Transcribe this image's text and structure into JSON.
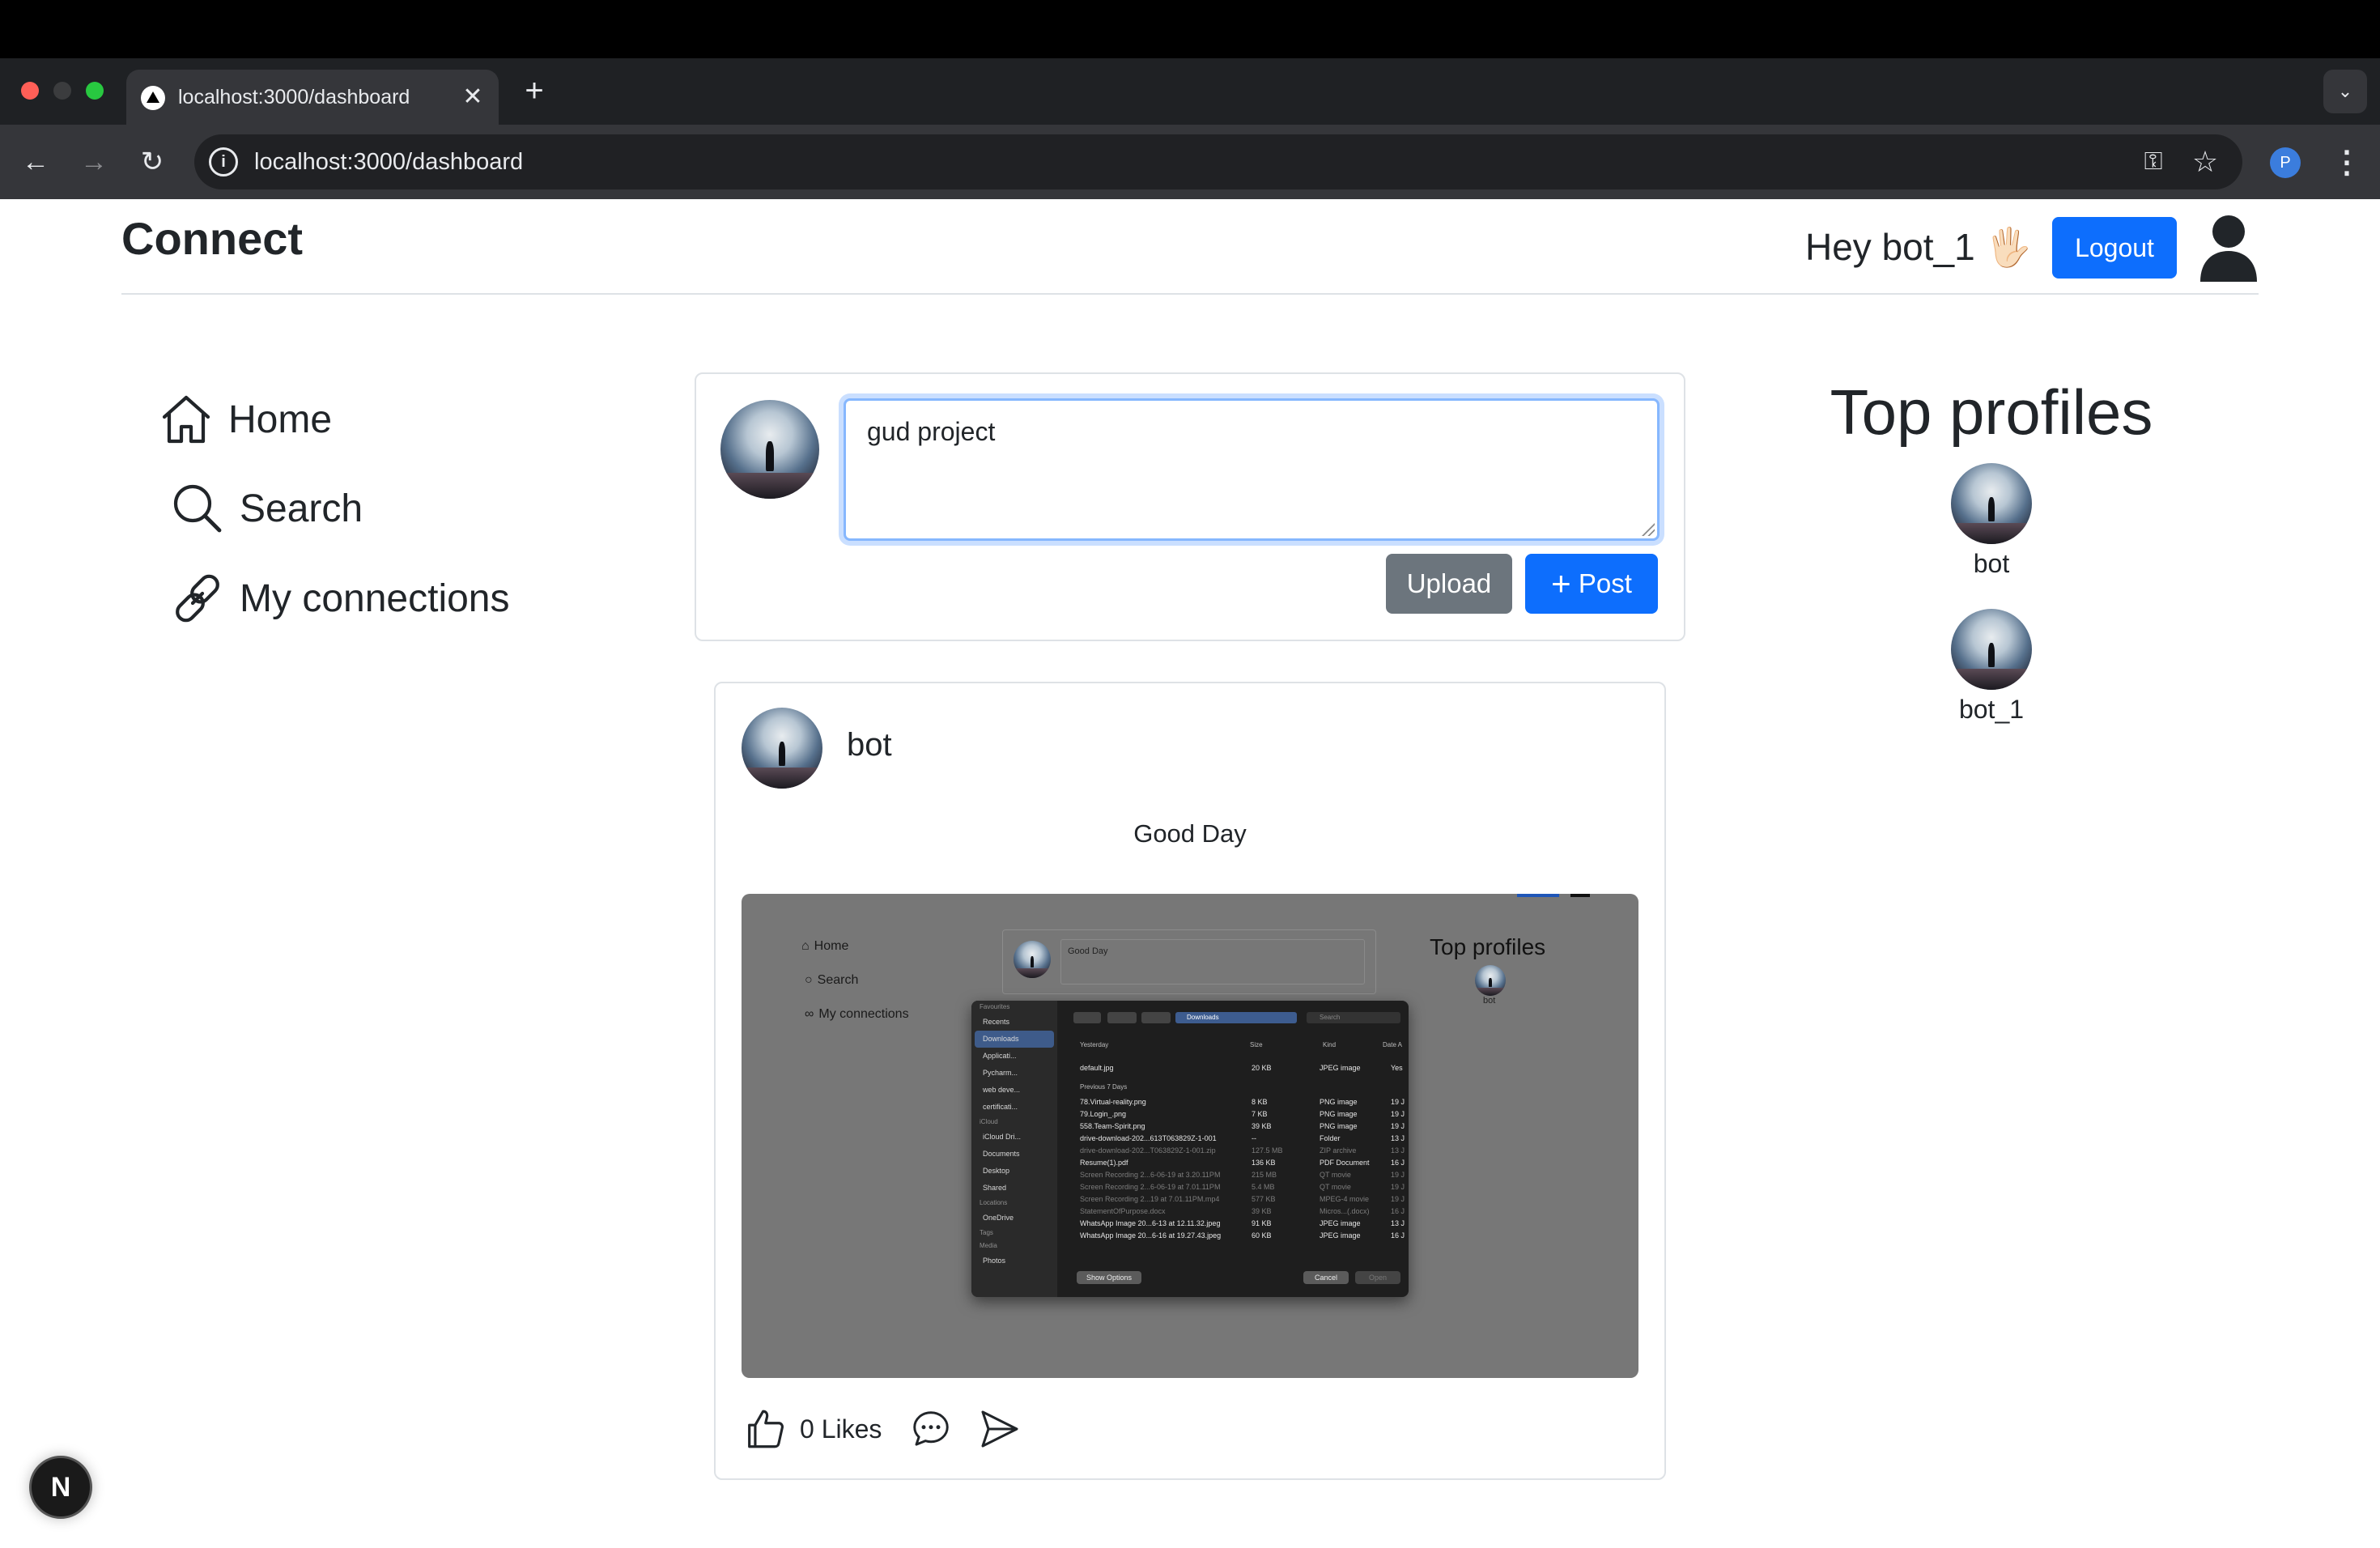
{
  "browser": {
    "tab_title": "localhost:3000/dashboard",
    "url": "localhost:3000/dashboard",
    "profile_initial": "P"
  },
  "header": {
    "brand": "Connect",
    "greeting": "Hey bot_1 🖐🏻",
    "logout_label": "Logout"
  },
  "sidebar": {
    "items": [
      {
        "label": "Home",
        "icon": "house-icon"
      },
      {
        "label": "Search",
        "icon": "search-icon"
      },
      {
        "label": "My connections",
        "icon": "link-icon"
      }
    ]
  },
  "composer": {
    "value": "gud project",
    "upload_label": "Upload",
    "post_label": "Post"
  },
  "post": {
    "author": "bot",
    "text": "Good Day",
    "likes": "0 Likes",
    "image": {
      "side_items": [
        "Home",
        "Search",
        "My connections"
      ],
      "composer_text": "Good Day",
      "top_profiles_title": "Top profiles",
      "top_profile_name": "bot",
      "dialog": {
        "sidebar": [
          {
            "label": "Favourites",
            "header": true
          },
          {
            "label": "Recents"
          },
          {
            "label": "Downloads",
            "selected": true
          },
          {
            "label": "Applicati..."
          },
          {
            "label": "Pycharm..."
          },
          {
            "label": "web deve..."
          },
          {
            "label": "certificati..."
          },
          {
            "label": "iCloud",
            "header": true
          },
          {
            "label": "iCloud Dri..."
          },
          {
            "label": "Documents"
          },
          {
            "label": "Desktop"
          },
          {
            "label": "Shared"
          },
          {
            "label": "Locations",
            "header": true
          },
          {
            "label": "OneDrive"
          },
          {
            "label": "Tags",
            "header": true
          },
          {
            "label": "Media",
            "header": true
          },
          {
            "label": "Photos"
          }
        ],
        "location": "Downloads",
        "search_placeholder": "Search",
        "columns": [
          "Yesterday",
          "Size",
          "Kind",
          "Date A"
        ],
        "section_previous": "Previous 7 Days",
        "rows": [
          {
            "name": "default.jpg",
            "size": "20 KB",
            "kind": "JPEG image",
            "date": "Yes"
          },
          {
            "name": "78.Virtual-reality.png",
            "size": "8 KB",
            "kind": "PNG image",
            "date": "19 J"
          },
          {
            "name": "79.Login_.png",
            "size": "7 KB",
            "kind": "PNG image",
            "date": "19 J"
          },
          {
            "name": "558.Team-Spirit.png",
            "size": "39 KB",
            "kind": "PNG image",
            "date": "19 J"
          },
          {
            "name": "drive-download-202...613T063829Z-1-001",
            "size": "--",
            "kind": "Folder",
            "date": "13 J"
          },
          {
            "name": "drive-download-202...T063829Z-1-001.zip",
            "size": "127.5 MB",
            "kind": "ZIP archive",
            "date": "13 J",
            "dim": true
          },
          {
            "name": "Resume(1).pdf",
            "size": "136 KB",
            "kind": "PDF Document",
            "date": "16 J"
          },
          {
            "name": "Screen Recording 2...6-06-19 at 3.20.11PM",
            "size": "215 MB",
            "kind": "QT movie",
            "date": "19 J",
            "dim": true
          },
          {
            "name": "Screen Recording 2...6-06-19 at 7.01.11PM",
            "size": "5.4 MB",
            "kind": "QT movie",
            "date": "19 J",
            "dim": true
          },
          {
            "name": "Screen Recording 2...19 at 7.01.11PM.mp4",
            "size": "577 KB",
            "kind": "MPEG-4 movie",
            "date": "19 J",
            "dim": true
          },
          {
            "name": "StatementOfPurpose.docx",
            "size": "39 KB",
            "kind": "Micros...(.docx)",
            "date": "16 J",
            "dim": true
          },
          {
            "name": "WhatsApp Image 20...6-13 at 12.11.32.jpeg",
            "size": "91 KB",
            "kind": "JPEG image",
            "date": "13 J"
          },
          {
            "name": "WhatsApp Image 20...6-16 at 19.27.43.jpeg",
            "size": "60 KB",
            "kind": "JPEG image",
            "date": "16 J"
          }
        ],
        "show_options": "Show Options",
        "cancel": "Cancel",
        "open": "Open"
      }
    }
  },
  "top_profiles": {
    "title": "Top profiles",
    "profiles": [
      {
        "name": "bot"
      },
      {
        "name": "bot_1"
      }
    ]
  },
  "dev_indicator": "N",
  "colors": {
    "primary": "#0d6efd",
    "secondary": "#6c757d",
    "chrome_dark": "#35363a"
  }
}
